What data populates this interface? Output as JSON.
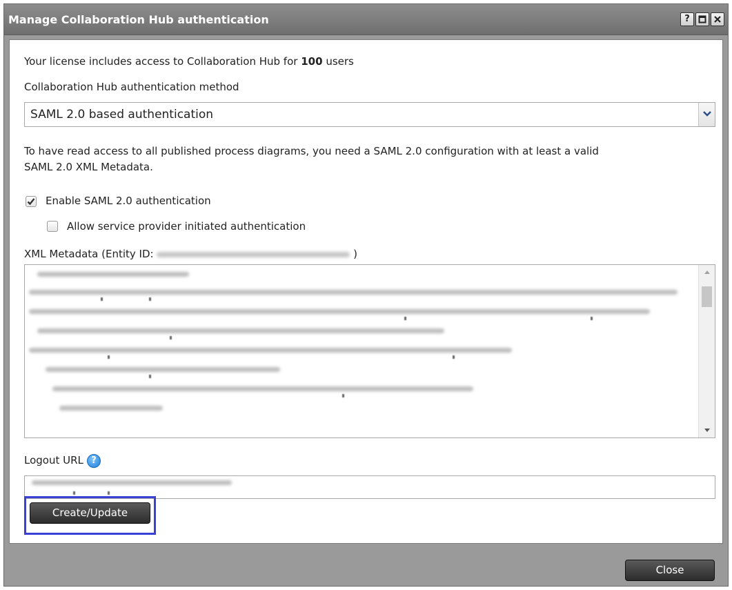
{
  "dialog": {
    "title": "Manage Collaboration Hub authentication",
    "help_icon": "?",
    "close_button": "Close"
  },
  "license": {
    "prefix": "Your license includes access to Collaboration Hub for",
    "count": "100",
    "suffix": "users"
  },
  "auth_method": {
    "label": "Collaboration Hub authentication method",
    "selected": "SAML 2.0 based authentication"
  },
  "info_text_line1": "To have read access to all published process diagrams, you need a SAML 2.0 configuration with at least a valid",
  "info_text_line2": "SAML 2.0 XML Metadata.",
  "checkboxes": {
    "enable_saml": {
      "label": "Enable SAML 2.0 authentication",
      "checked": true
    },
    "sp_initiated": {
      "label": "Allow service provider initiated authentication",
      "checked": false
    }
  },
  "metadata": {
    "label_prefix": "XML Metadata (Entity ID:",
    "label_suffix": ")"
  },
  "logout": {
    "label": "Logout URL"
  },
  "create_update_button": "Create/Update",
  "icons": [
    "help-icon",
    "maximize-icon",
    "close-icon",
    "chevron-down-icon",
    "checkmark-icon",
    "scroll-up-icon",
    "scroll-down-icon",
    "question-icon"
  ],
  "colors": {
    "titlebar": "#7d7d7d",
    "focus": "#3a3fd6",
    "help": "#1f7fd6"
  }
}
